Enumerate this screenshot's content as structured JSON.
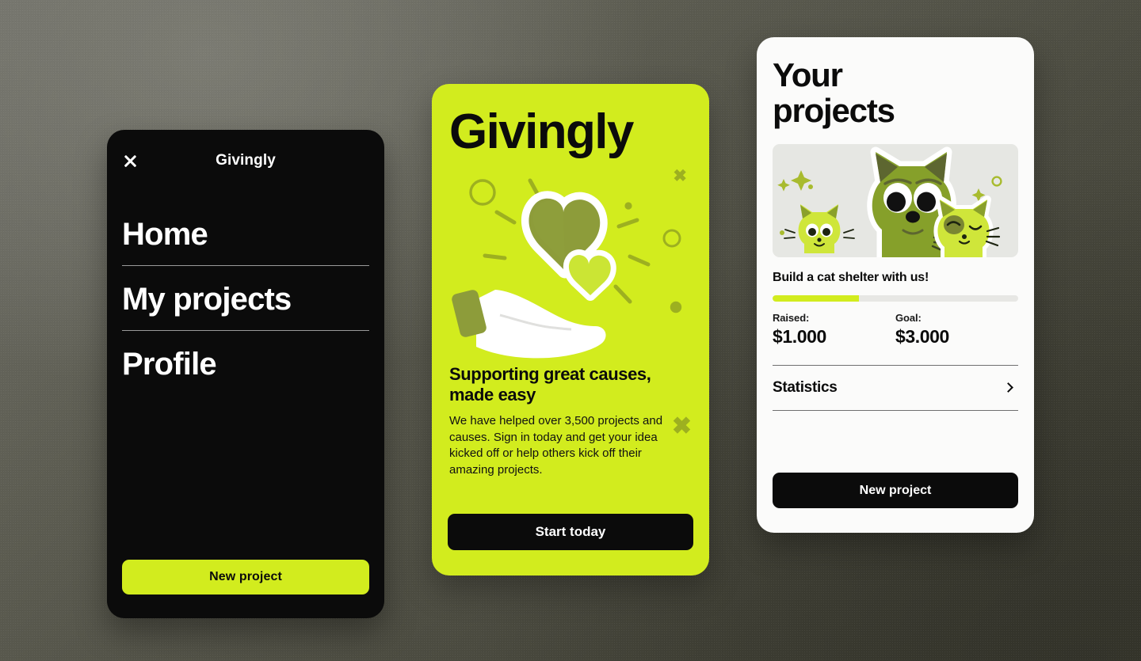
{
  "background": {
    "gradient_from": "#71716a",
    "gradient_to": "#3a3a2f"
  },
  "theme": {
    "accent_green": "#d2ec1e",
    "ink": "#0b0b0b",
    "paper": "#fbfbfa"
  },
  "menu_panel": {
    "close_icon": "close-icon",
    "brand": "Givingly",
    "items": [
      {
        "label": "Home"
      },
      {
        "label": "My projects"
      },
      {
        "label": "Profile"
      }
    ],
    "cta_label": "New project"
  },
  "promo_card": {
    "logo": "Givingly",
    "illustration": "hand-holding-hearts-illustration",
    "headline": "Supporting great causes, made easy",
    "body": "We have helped over 3,500 projects and causes. Sign in today and get your idea kicked off or help others kick off their amazing projects.",
    "cta_label": "Start today",
    "decorations": [
      {
        "name": "cross-mark-small",
        "glyph": "✖"
      },
      {
        "name": "cross-mark-large",
        "glyph": "✖"
      }
    ]
  },
  "projects_card": {
    "title": "Your\nprojects",
    "project": {
      "thumbnail": "green-cats-illustration",
      "name": "Build a cat shelter with us!",
      "progress_percent": 35,
      "raised_label": "Raised:",
      "raised_value": "$1.000",
      "goal_label": "Goal:",
      "goal_value": "$3.000"
    },
    "statistics_label": "Statistics",
    "statistics_chevron": "chevron-right-icon",
    "cta_label": "New project"
  }
}
